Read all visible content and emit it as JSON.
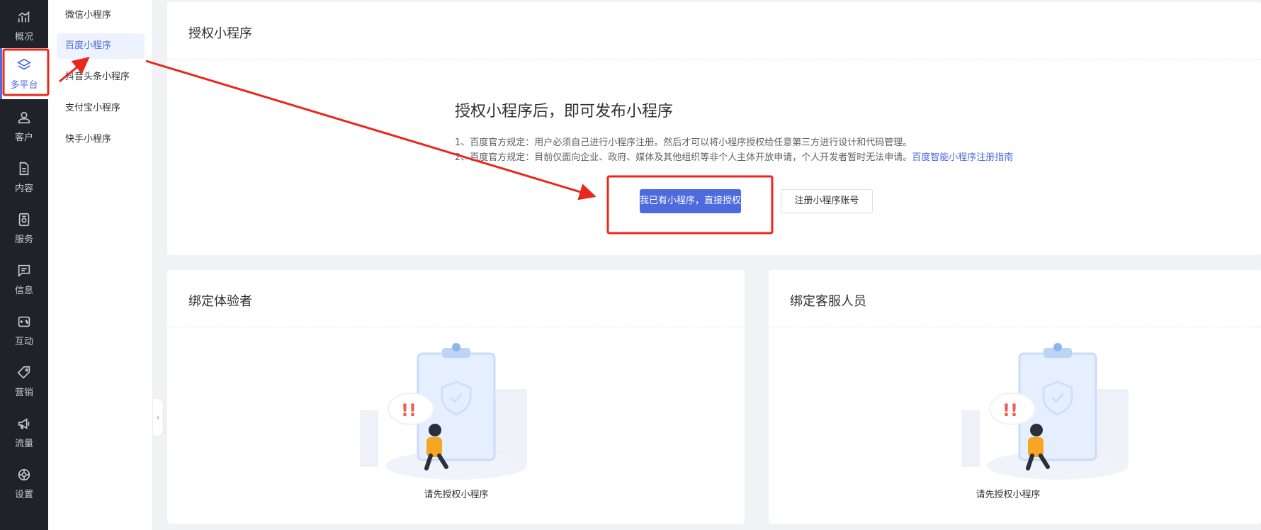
{
  "rail": {
    "items": [
      {
        "label": "概况",
        "icon": "chart-icon"
      },
      {
        "label": "多平台",
        "icon": "layers-icon",
        "active": true
      },
      {
        "label": "客户",
        "icon": "user-icon"
      },
      {
        "label": "内容",
        "icon": "document-icon"
      },
      {
        "label": "服务",
        "icon": "service-icon"
      },
      {
        "label": "信息",
        "icon": "message-icon"
      },
      {
        "label": "互动",
        "icon": "gamepad-icon"
      },
      {
        "label": "营销",
        "icon": "tag-icon"
      },
      {
        "label": "流量",
        "icon": "megaphone-icon"
      },
      {
        "label": "设置",
        "icon": "gear-icon"
      }
    ]
  },
  "submenu": {
    "items": [
      {
        "label": "微信小程序"
      },
      {
        "label": "百度小程序",
        "active": true
      },
      {
        "label": "抖音头条小程序"
      },
      {
        "label": "支付宝小程序"
      },
      {
        "label": "快手小程序"
      }
    ]
  },
  "auth": {
    "title": "授权小程序",
    "headline": "授权小程序后，即可发布小程序",
    "rule1": "1、百度官方规定：用户必须自己进行小程序注册。然后才可以将小程序授权给任意第三方进行设计和代码管理。",
    "rule2": "2、百度官方规定：目前仅面向企业、政府、媒体及其他组织等非个人主体开放申请，个人开发者暂时无法申请。",
    "rule2_link": "百度智能小程序注册指南",
    "primary_button": "我已有小程序，直接授权",
    "secondary_button": "注册小程序账号"
  },
  "bind_tester": {
    "title": "绑定体验者",
    "empty_text": "请先授权小程序"
  },
  "bind_service": {
    "title": "绑定客服人员",
    "empty_text": "请先授权小程序"
  },
  "colors": {
    "accent": "#4d6bdc",
    "rail_bg": "#1f2329",
    "annotation_red": "#e8281f"
  }
}
